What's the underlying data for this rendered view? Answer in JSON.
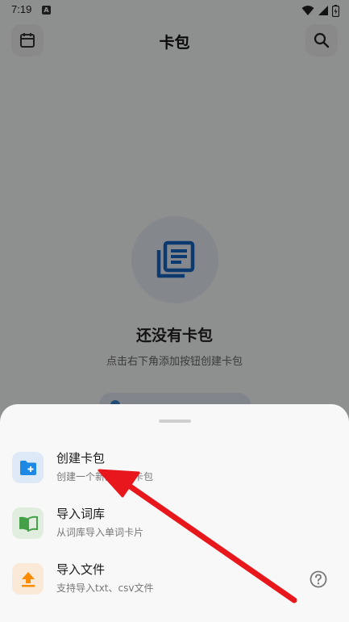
{
  "status_bar": {
    "time": "7:19",
    "app_icon_letter": "A"
  },
  "header": {
    "title": "卡包",
    "left_icon": "calendar-icon",
    "right_icon": "search-icon"
  },
  "empty_state": {
    "icon": "stacked-cards-icon",
    "title": "还没有卡包",
    "subtitle": "点击右下角添加按钮创建卡包"
  },
  "sheet": {
    "options": [
      {
        "title": "创建卡包",
        "subtitle": "创建一个新的学习卡包",
        "icon": "folder-add-icon",
        "color": "#1e88e5"
      },
      {
        "title": "导入词库",
        "subtitle": "从词库导入单词卡片",
        "icon": "book-icon",
        "color": "#43a047"
      },
      {
        "title": "导入文件",
        "subtitle": "支持导入txt、csv文件",
        "icon": "upload-icon",
        "color": "#fb8c00"
      }
    ],
    "help_icon": "help-circle-icon"
  },
  "annotation": {
    "color": "#e8171b"
  }
}
